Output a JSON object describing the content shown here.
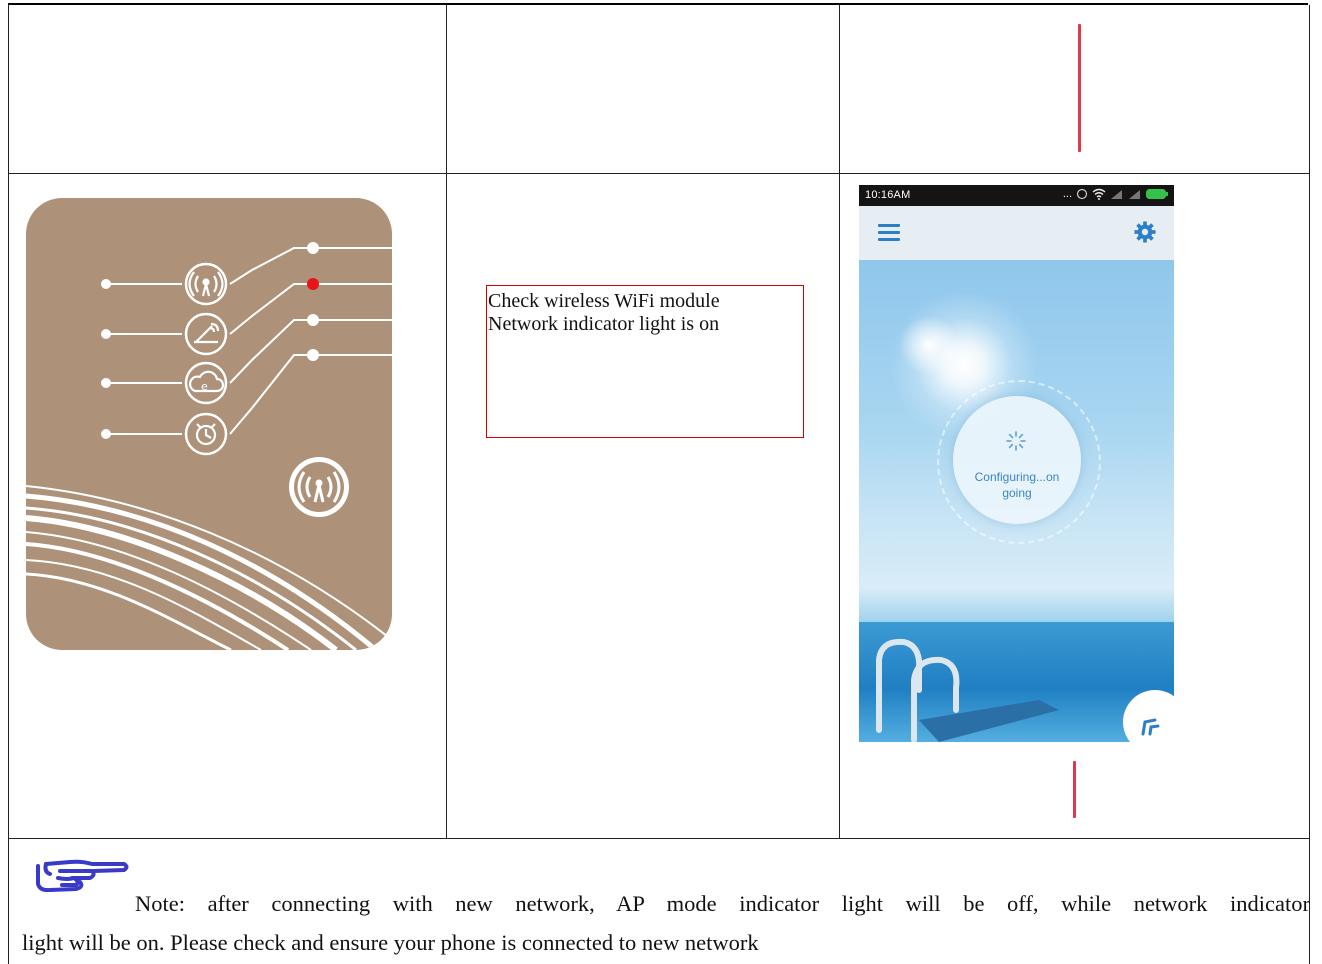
{
  "callout": {
    "line1": "Check wireless WiFi module",
    "line2": "Network indicator light is on"
  },
  "phone": {
    "status_time": "10:16AM",
    "status_dots": "...",
    "configuring_line1": "Configuring...on",
    "configuring_line2": "going"
  },
  "note": {
    "line1": "Note: after connecting with new network, AP mode indicator light will be off, while network indicator",
    "line2": "light will be on. Please check and ensure your phone is connected to new network"
  },
  "colors": {
    "panel": "#ad9279",
    "indicator_on": "#e8141c",
    "callout_border": "#d40000",
    "app_accent": "#2c7fc7"
  },
  "icons": {
    "panel": [
      "wifi-signal-icon",
      "router-icon",
      "cloud-e-icon",
      "alarm-clock-icon",
      "wireless-logo-icon"
    ],
    "phone": [
      "menu-icon",
      "gear-icon",
      "loading-spinner-icon",
      "fab-icon"
    ],
    "note": "pointing-hand-icon"
  }
}
